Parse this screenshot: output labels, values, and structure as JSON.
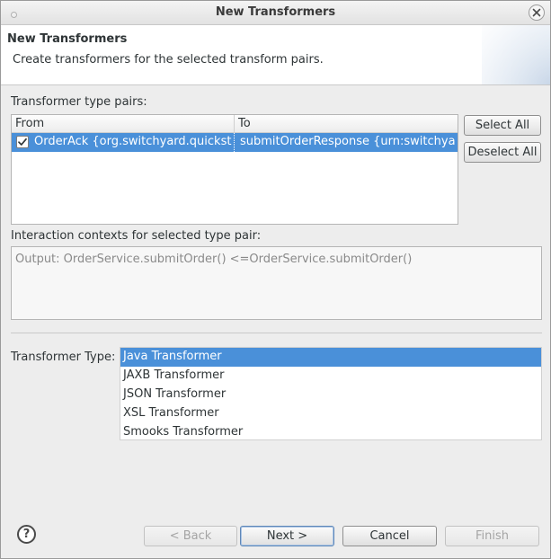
{
  "window": {
    "title": "New Transformers"
  },
  "banner": {
    "title": "New Transformers",
    "description": "Create transformers for the selected transform pairs."
  },
  "type_pairs": {
    "label": "Transformer type pairs:",
    "columns": [
      "From",
      "To"
    ],
    "rows": [
      {
        "checked": true,
        "from": "OrderAck {org.switchyard.quickstart",
        "to": "submitOrderResponse {urn:switchyard"
      }
    ],
    "select_all": "Select All",
    "deselect_all": "Deselect All"
  },
  "contexts": {
    "label": "Interaction contexts for selected type pair:",
    "text": "Output: OrderService.submitOrder() <=OrderService.submitOrder()"
  },
  "transformer_type": {
    "label": "Transformer Type:",
    "options": [
      "Java Transformer",
      "JAXB Transformer",
      "JSON Transformer",
      "XSL Transformer",
      "Smooks Transformer"
    ],
    "selected": "Java Transformer"
  },
  "footer": {
    "back": "< Back",
    "next": "Next >",
    "cancel": "Cancel",
    "finish": "Finish",
    "help_icon": "question-mark-icon"
  },
  "colors": {
    "selection": "#4a90d9",
    "background": "#ededed"
  }
}
